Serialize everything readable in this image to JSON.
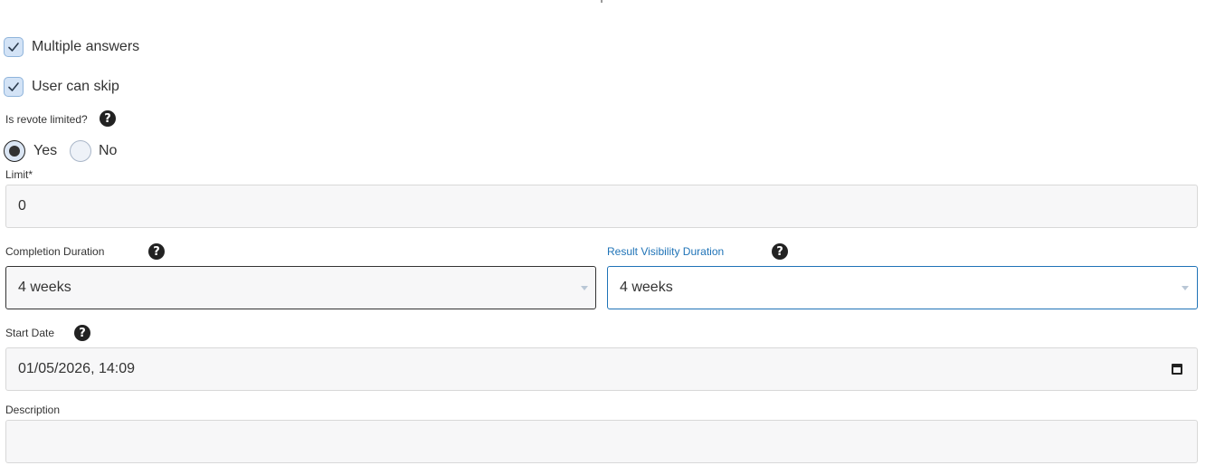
{
  "options": {
    "multiple_answers": {
      "label": "Multiple answers",
      "checked": true
    },
    "user_can_skip": {
      "label": "User can skip",
      "checked": true
    }
  },
  "revote": {
    "label": "Is revote limited?",
    "help_icon": "question-circle-icon",
    "choices": [
      {
        "label": "Yes",
        "selected": true
      },
      {
        "label": "No",
        "selected": false
      }
    ]
  },
  "limit": {
    "label": "Limit",
    "required_mark": "*",
    "value": "0"
  },
  "completion_duration": {
    "label": "Completion Duration",
    "value": "4 weeks",
    "help_icon": "question-circle-icon"
  },
  "result_visibility_duration": {
    "label": "Result Visibility Duration",
    "value": "4 weeks",
    "help_icon": "question-circle-icon"
  },
  "start_date": {
    "label": "Start Date",
    "value": "01/05/2026, 14:09",
    "help_icon": "question-circle-icon",
    "trailing_icon": "calendar-icon"
  },
  "description": {
    "label": "Description",
    "value": ""
  },
  "colors": {
    "accent": "#1f73b7",
    "field_bg": "#f7f7f8",
    "checkbox_bg": "#d3e3f6"
  }
}
